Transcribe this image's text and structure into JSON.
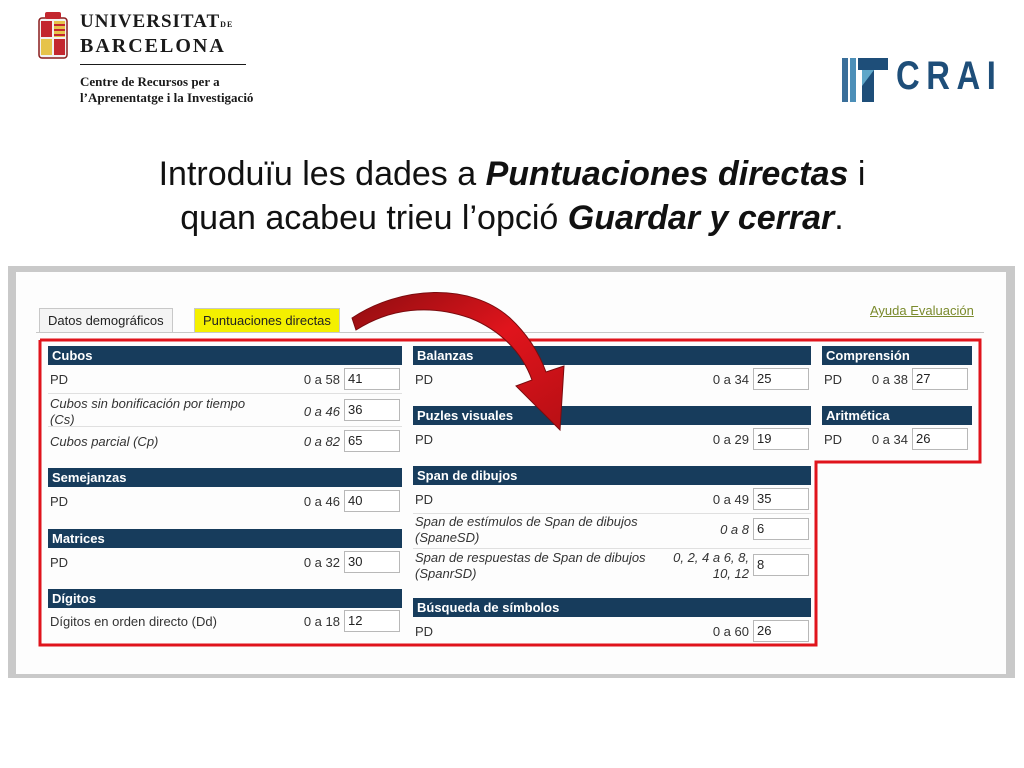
{
  "header": {
    "ub_line1": "UNIVERSITAT",
    "ub_de": "DE",
    "ub_line2": "BARCELONA",
    "ub_sub1": "Centre de Recursos per a",
    "ub_sub2": "l’Aprenentatge i la Investigació",
    "crai": "CRAI"
  },
  "title": {
    "line1_a": "Introduïu les dades a ",
    "line1_b": "Puntuaciones directas",
    "line1_c": " i",
    "line2_a": "quan acabeu trieu l’opció ",
    "line2_b": "Guardar y cerrar",
    "line2_c": "."
  },
  "tabs": {
    "tab1": "Datos demográficos",
    "tab2": "Puntuaciones directas",
    "help": "Ayuda Evaluación"
  },
  "panels": {
    "cubos": {
      "title": "Cubos",
      "r1": {
        "label": "PD",
        "range": "0 a 58",
        "value": "41"
      },
      "r2": {
        "label": "Cubos sin bonificación por tiempo (Cs)",
        "range": "0 a 46",
        "value": "36"
      },
      "r3": {
        "label": "Cubos parcial (Cp)",
        "range": "0 a 82",
        "value": "65"
      }
    },
    "semejanzas": {
      "title": "Semejanzas",
      "r1": {
        "label": "PD",
        "range": "0 a 46",
        "value": "40"
      }
    },
    "matrices": {
      "title": "Matrices",
      "r1": {
        "label": "PD",
        "range": "0 a 32",
        "value": "30"
      }
    },
    "digitos": {
      "title": "Dígitos",
      "r1": {
        "label": "Dígitos en orden directo (Dd)",
        "range": "0 a 18",
        "value": "12"
      }
    },
    "balanzas": {
      "title": "Balanzas",
      "r1": {
        "label": "PD",
        "range": "0 a 34",
        "value": "25"
      }
    },
    "puzles": {
      "title": "Puzles visuales",
      "r1": {
        "label": "PD",
        "range": "0 a 29",
        "value": "19"
      }
    },
    "span": {
      "title": "Span de dibujos",
      "r1": {
        "label": "PD",
        "range": "0 a 49",
        "value": "35"
      },
      "r2": {
        "label": "Span de estímulos de Span de dibujos (SpaneSD)",
        "range": "0 a 8",
        "value": "6"
      },
      "r3": {
        "label": "Span de respuestas de Span de dibujos (SpanrSD)",
        "range": "0, 2, 4 a 6, 8, 10, 12",
        "value": "8"
      }
    },
    "busqueda": {
      "title": "Búsqueda de símbolos",
      "r1": {
        "label": "PD",
        "range": "0 a 60",
        "value": "26"
      }
    },
    "comprension": {
      "title": "Comprensión",
      "r1": {
        "label": "PD",
        "range": "0 a 38",
        "value": "27"
      }
    },
    "aritmetica": {
      "title": "Aritmética",
      "r1": {
        "label": "PD",
        "range": "0 a 34",
        "value": "26"
      }
    }
  },
  "colors": {
    "panel_header": "#173c5c",
    "highlight_tab": "#f4f000",
    "annotation_red": "#e0141c",
    "crai_blue": "#1e4e79"
  }
}
